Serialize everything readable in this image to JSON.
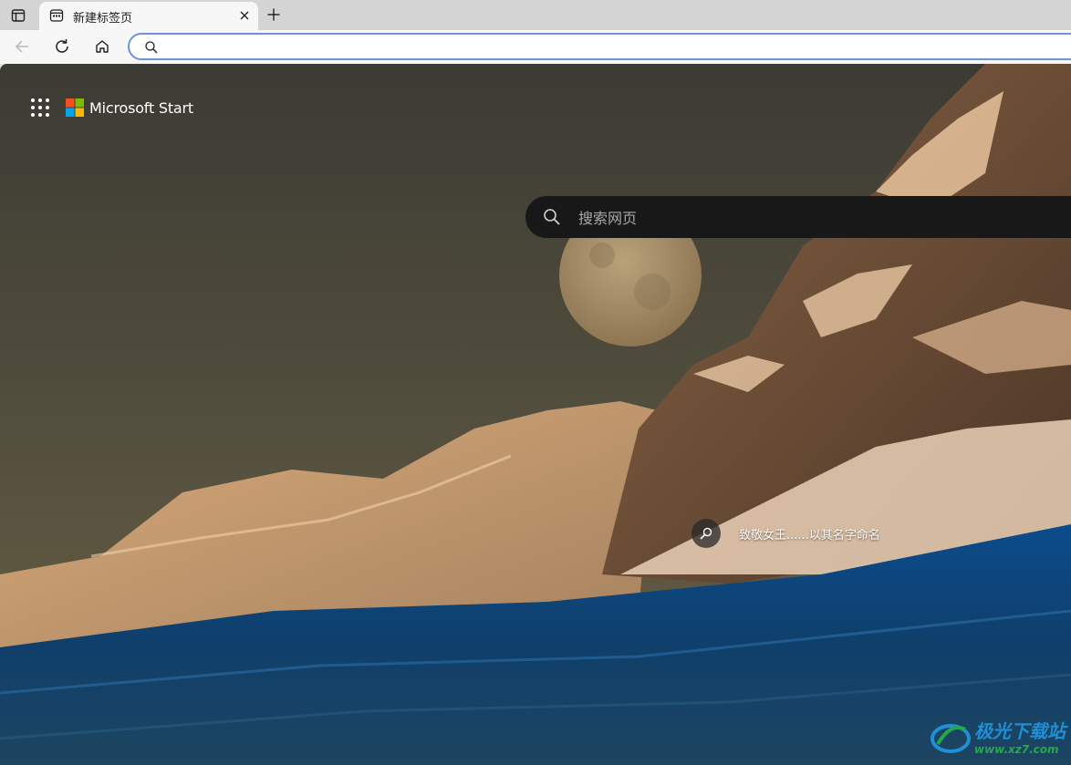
{
  "browser": {
    "tab": {
      "title": "新建标签页"
    },
    "address_bar": {
      "value": "",
      "placeholder": ""
    }
  },
  "page": {
    "brand": {
      "name": "Microsoft Start"
    },
    "search": {
      "placeholder": "搜索网页"
    },
    "caption": {
      "text": "致敬女王......以其名字命名"
    }
  },
  "watermark": {
    "name": "极光下载站",
    "url": "www.xz7.com"
  },
  "icons": {
    "tab_actions": "tab-actions-icon",
    "tab_favicon": "new-tab-page-icon",
    "tab_close": "close-icon",
    "new_tab": "plus-icon",
    "back": "back-arrow-icon",
    "refresh": "refresh-icon",
    "home": "home-icon",
    "address_search": "search-icon",
    "apps": "app-launcher-icon",
    "page_search": "search-icon",
    "caption": "image-info-icon"
  },
  "colors": {
    "accent_border": "#6e93d6",
    "tab_bar": "#d4d4d4",
    "toolbar": "#f7f7f7",
    "search_box": "#181818",
    "logo_red": "#f25022",
    "logo_green": "#7fba00",
    "logo_blue": "#00a4ef",
    "logo_yellow": "#ffb900"
  }
}
